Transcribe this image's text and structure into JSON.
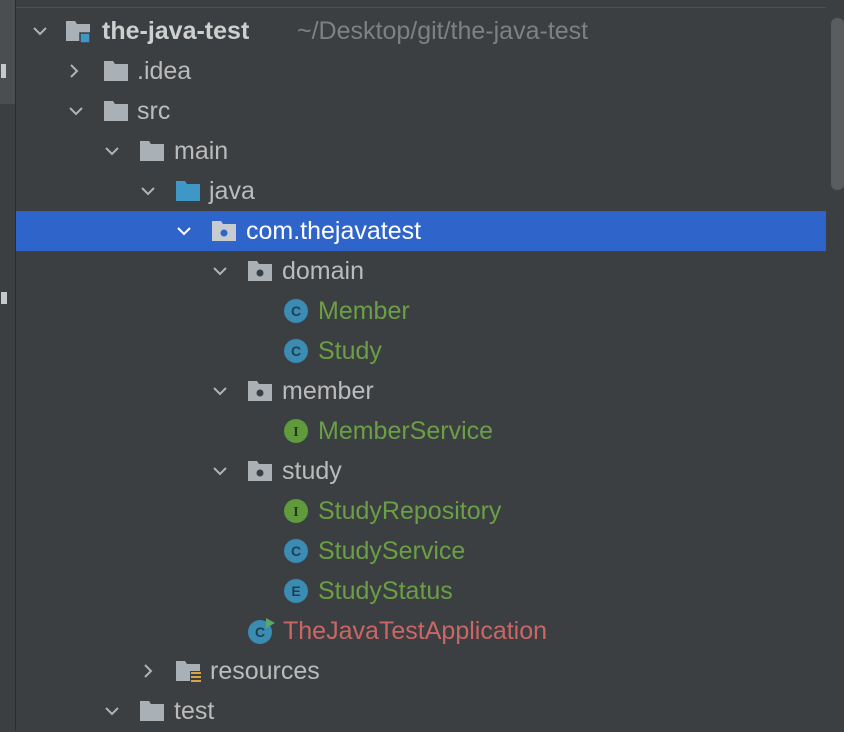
{
  "colors": {
    "background": "#3c3f41",
    "selection": "#2f65ca",
    "folder": "#a9b0b6",
    "source_folder": "#3e97c5",
    "class_icon": "#3b8cb3",
    "interface_icon": "#5f9a3c",
    "text_green": "#6a9f45",
    "text_red": "#cc6666"
  },
  "project": {
    "name": "the-java-test",
    "path": "~/Desktop/git/the-java-test"
  },
  "nodes": {
    "idea": ".idea",
    "src": "src",
    "main": "main",
    "java": "java",
    "package": "com.thejavatest",
    "domain": "domain",
    "member_class": "Member",
    "study_class": "Study",
    "member_pkg": "member",
    "member_service": "MemberService",
    "study_pkg": "study",
    "study_repository": "StudyRepository",
    "study_service": "StudyService",
    "study_status": "StudyStatus",
    "app": "TheJavaTestApplication",
    "resources": "resources",
    "test": "test"
  },
  "badges": {
    "class": "C",
    "interface": "I",
    "enum": "E"
  },
  "icons": {
    "expanded": "chevron-down-icon",
    "collapsed": "chevron-right-icon",
    "folder": "folder-icon",
    "package": "package-icon",
    "class": "class-icon",
    "interface": "interface-icon",
    "enum": "enum-icon",
    "run_class": "run-class-icon"
  }
}
